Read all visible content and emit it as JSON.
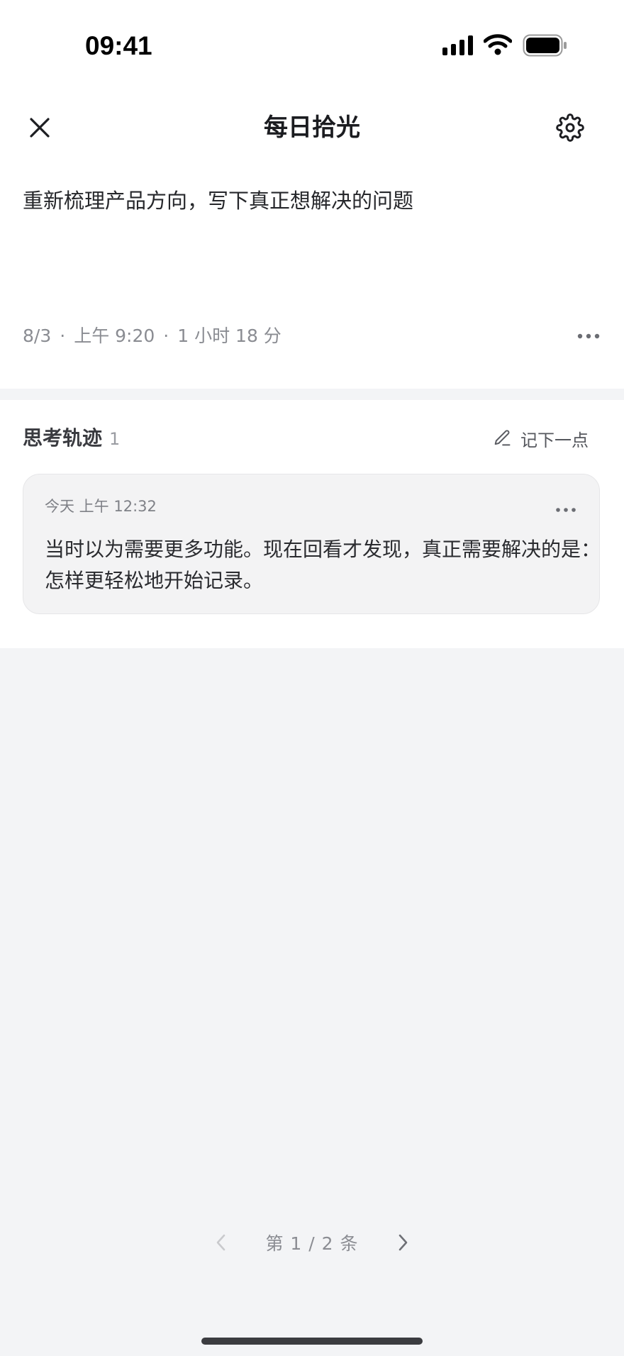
{
  "status_bar": {
    "time": "09:41"
  },
  "header": {
    "title": "每日拾光",
    "close_icon": "close-icon",
    "settings_icon": "gear-icon"
  },
  "task": {
    "text": "重新梳理产品方向，写下真正想解决的问题",
    "meta": {
      "date": "8/3",
      "time": "上午 9:20",
      "duration": "1 小时 18 分",
      "separator": "·"
    }
  },
  "thinking": {
    "title": "思考轨迹",
    "count": "1",
    "add_label": "记下一点",
    "notes": [
      {
        "time": "今天 上午 12:32",
        "text": "当时以为需要更多功能。现在回看才发现，真正需要解决的是：怎样更轻松地开始记录。"
      }
    ]
  },
  "pager": {
    "label": "第 1 / 2 条"
  }
}
